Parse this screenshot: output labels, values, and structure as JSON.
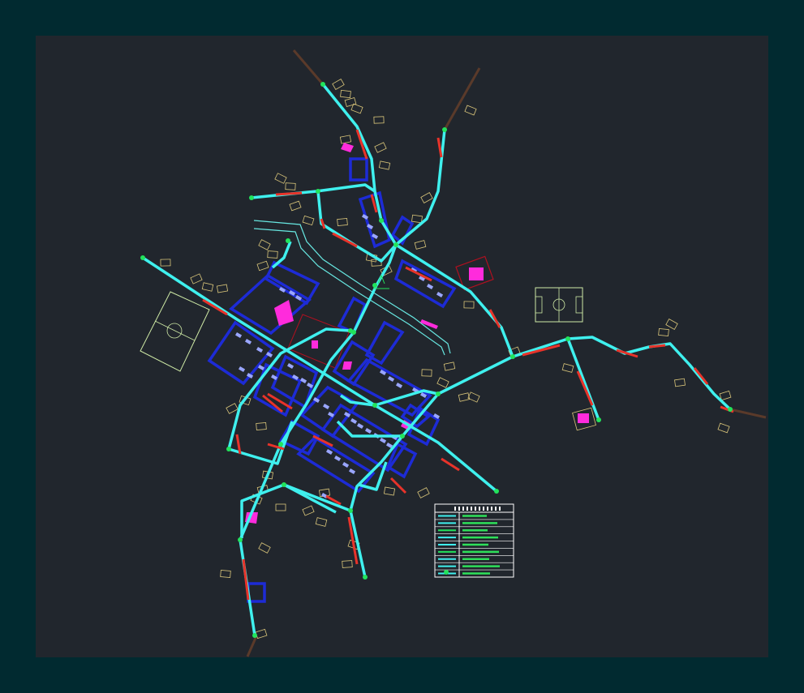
{
  "colors": {
    "frame": "#012a30",
    "paper": "#21262d",
    "network": "#3ff0ee",
    "network_alt": "#e8332a",
    "blocks": "#1d2bd6",
    "lots": "#d9c57a",
    "buildings": "#9aa6ff",
    "public_buildings": "#ff2bdc",
    "nodes": "#22e35c",
    "sports_field": "#cfeaa6",
    "stream": "#67e6e0",
    "plaza": "#b01020",
    "roads_outside": "#5a3a2a",
    "legend_text": "#2ee05a",
    "legend_frame": "#ffffff"
  },
  "legend": {
    "rows": 9
  }
}
